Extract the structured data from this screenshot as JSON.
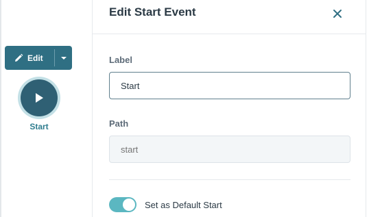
{
  "canvas": {
    "edit_button": {
      "label": "Edit",
      "icon": "pencil-icon",
      "dropdown_icon": "caret-down-icon"
    },
    "start_node": {
      "label": "Start",
      "icon": "play-icon"
    }
  },
  "panel": {
    "title": "Edit Start Event",
    "close_icon": "close-icon",
    "fields": {
      "label": {
        "title": "Label",
        "value": "Start"
      },
      "path": {
        "title": "Path",
        "placeholder": "start"
      }
    },
    "default_start": {
      "label": "Set as Default Start",
      "checked": true
    }
  },
  "colors": {
    "edit_button": "#2f6f83",
    "start_node": "#2f6074",
    "start_node_ring": "#c3e0e6",
    "start_label": "#2f7d8f",
    "toggle_on": "#5bb7c1",
    "close_icon": "#2f6f83"
  }
}
